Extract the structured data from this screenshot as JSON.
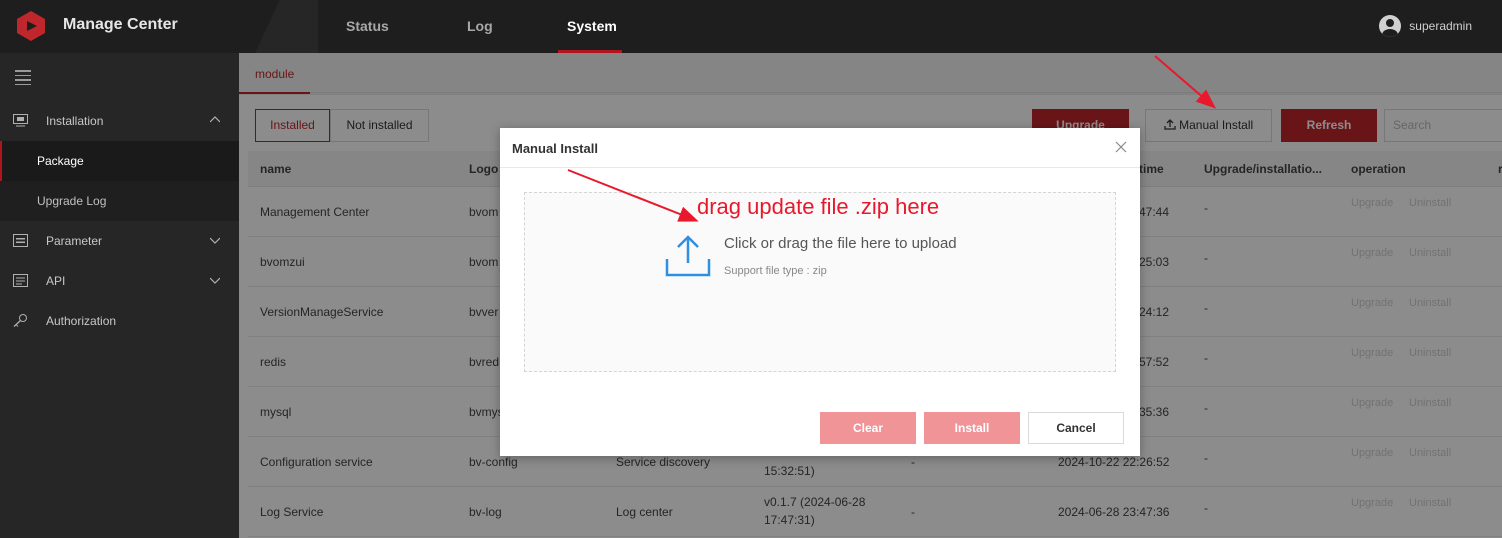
{
  "topbar": {
    "title": "Manage Center",
    "tabs": [
      "Status",
      "Log",
      "System"
    ],
    "active_tab": "System",
    "username": "superadmin"
  },
  "sidebar": {
    "items": [
      {
        "label": "Installation",
        "icon": "monitor-icon",
        "expanded": true
      },
      {
        "label": "Package",
        "active": true
      },
      {
        "label": "Upgrade Log"
      },
      {
        "label": "Parameter",
        "icon": "list-icon"
      },
      {
        "label": "API",
        "icon": "api-doc-icon"
      },
      {
        "label": "Authorization",
        "icon": "key-icon"
      }
    ]
  },
  "main": {
    "module_tab": "module",
    "filter": {
      "installed": "Installed",
      "not_installed": "Not installed"
    },
    "buttons": {
      "upgrade": "Upgrade",
      "manual_install": "Manual Install",
      "refresh": "Refresh"
    },
    "search_placeholder": "Search",
    "columns": [
      "name",
      "Logo",
      "time",
      "Upgrade/installatio...",
      "operation",
      "r"
    ],
    "rows": [
      {
        "name": "Management Center",
        "logo": "bvom",
        "time": "47:44",
        "status": "-",
        "upgrade": "Upgrade",
        "uninstall": "Uninstall"
      },
      {
        "name": "bvomzui",
        "logo": "bvom",
        "time": "25:03",
        "status": "-",
        "upgrade": "Upgrade",
        "uninstall": "Uninstall"
      },
      {
        "name": "VersionManageService",
        "logo": "bvver",
        "time": "24:12",
        "status": "-",
        "upgrade": "Upgrade",
        "uninstall": "Uninstall"
      },
      {
        "name": "redis",
        "logo": "bvred",
        "time": "57:52",
        "status": "-",
        "upgrade": "Upgrade",
        "uninstall": "Uninstall"
      },
      {
        "name": "mysql",
        "logo": "bvmys",
        "time": "35:36",
        "status": "-",
        "upgrade": "Upgrade",
        "uninstall": "Uninstall"
      },
      {
        "name": "Configuration service",
        "logo": "bv-config",
        "desc": "Service discovery",
        "version": "15:32:51)",
        "dash": "-",
        "time": "2024-10-22 22:26:52",
        "status": "-",
        "upgrade": "Upgrade",
        "uninstall": "Uninstall"
      },
      {
        "name": "Log Service",
        "logo": "bv-log",
        "desc": "Log center",
        "version": "v0.1.7 (2024-06-28",
        "version2": "17:47:31)",
        "dash": "-",
        "time": "2024-06-28 23:47:36",
        "status": "-",
        "upgrade": "Upgrade",
        "uninstall": "Uninstall"
      }
    ]
  },
  "modal": {
    "title": "Manual Install",
    "upload_text": "Click or drag the file here to upload",
    "upload_hint": "Support file type : zip",
    "annotation": "drag update file .zip here",
    "buttons": {
      "clear": "Clear",
      "install": "Install",
      "cancel": "Cancel"
    }
  },
  "colors": {
    "accent": "#c0272d",
    "annotation": "#e8192c",
    "upload_icon": "#2f8fe0"
  }
}
